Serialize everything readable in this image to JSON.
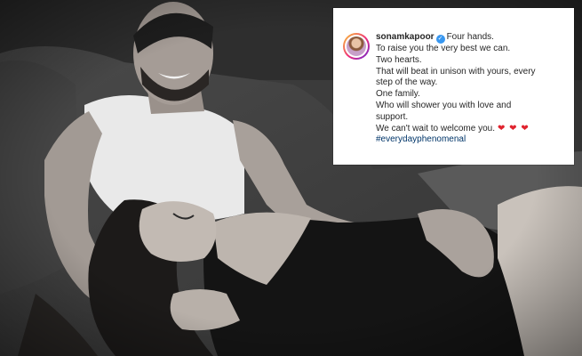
{
  "post": {
    "username": "sonamkapoor",
    "verified_icon": "verified-badge-icon",
    "caption_lines": [
      "Four hands.",
      "To raise you the very best we can.",
      "Two hearts.",
      "That will beat in unison with yours, every",
      "step of the way.",
      "One family.",
      "Who will shower you with love and",
      "support.",
      "We can't wait to welcome you."
    ],
    "hearts": "❤ ❤ ❤",
    "hashtag": "#everydayphenomenal"
  },
  "colors": {
    "hashtag": "#003569",
    "verified": "#3897f0",
    "hearts": "#e0232e"
  }
}
